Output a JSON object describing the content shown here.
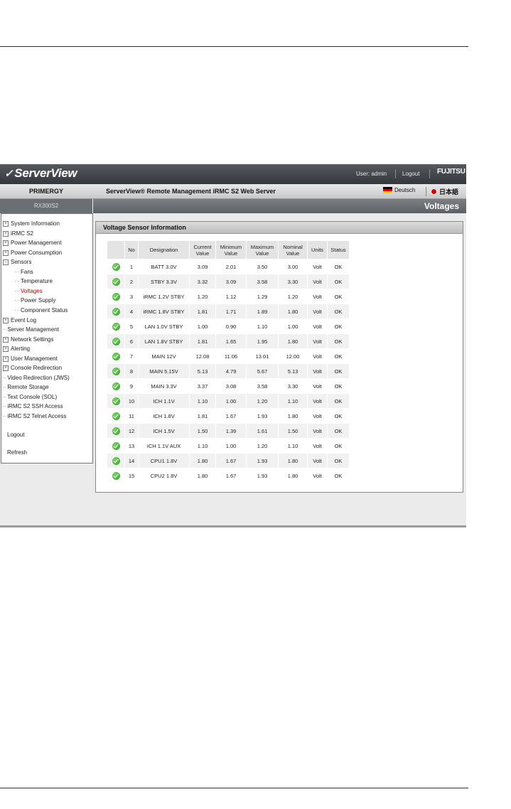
{
  "header": {
    "logo": "ServerView",
    "user": "User: admin",
    "logout": "Logout",
    "brand": "FUJITSU"
  },
  "subheader": {
    "product": "PRIMERGY",
    "title": "ServerView® Remote Management iRMC S2 Web Server",
    "lang_de": "Deutsch",
    "lang_jp": "日本語"
  },
  "model": "RX300S2",
  "page_title": "Voltages",
  "sidebar": {
    "items": [
      {
        "label": "System Information"
      },
      {
        "label": "iRMC S2"
      },
      {
        "label": "Power Management"
      },
      {
        "label": "Power Consumption"
      },
      {
        "label": "Sensors"
      },
      {
        "label": "Fans"
      },
      {
        "label": "Temperature"
      },
      {
        "label": "Voltages"
      },
      {
        "label": "Power Supply"
      },
      {
        "label": "Component Status"
      },
      {
        "label": "Event Log"
      },
      {
        "label": "Server Management"
      },
      {
        "label": "Network Settings"
      },
      {
        "label": "Alerting"
      },
      {
        "label": "User Management"
      },
      {
        "label": "Console Redirection"
      },
      {
        "label": "Video Redirection (JWS)"
      },
      {
        "label": "Remote Storage"
      },
      {
        "label": "Text Console (SOL)"
      },
      {
        "label": "iRMC S2 SSH Access"
      },
      {
        "label": "iRMC S2 Telnet Access"
      },
      {
        "label": "Logout"
      },
      {
        "label": "Refresh"
      }
    ]
  },
  "panel": {
    "title": "Voltage Sensor Information",
    "columns": {
      "no": "No",
      "designation": "Designation",
      "current_1": "Current",
      "current_2": "Value",
      "minimum_1": "Minimum",
      "minimum_2": "Value",
      "maximum_1": "Maximum",
      "maximum_2": "Value",
      "nominal_1": "Nominal",
      "nominal_2": "Value",
      "units": "Units",
      "status": "Status"
    },
    "rows": [
      {
        "no": "1",
        "designation": "BATT 3.0V",
        "current": "3.09",
        "minimum": "2.01",
        "maximum": "3.50",
        "nominal": "3.00",
        "units": "Volt",
        "status": "OK"
      },
      {
        "no": "2",
        "designation": "STBY 3.3V",
        "current": "3.32",
        "minimum": "3.09",
        "maximum": "3.58",
        "nominal": "3.30",
        "units": "Volt",
        "status": "OK"
      },
      {
        "no": "3",
        "designation": "iRMC 1.2V STBY",
        "current": "1.20",
        "minimum": "1.12",
        "maximum": "1.29",
        "nominal": "1.20",
        "units": "Volt",
        "status": "OK"
      },
      {
        "no": "4",
        "designation": "iRMC 1.8V STBY",
        "current": "1.81",
        "minimum": "1.71",
        "maximum": "1.89",
        "nominal": "1.80",
        "units": "Volt",
        "status": "OK"
      },
      {
        "no": "5",
        "designation": "LAN 1.0V STBY",
        "current": "1.00",
        "minimum": "0.90",
        "maximum": "1.10",
        "nominal": "1.00",
        "units": "Volt",
        "status": "OK"
      },
      {
        "no": "6",
        "designation": "LAN 1.8V STBY",
        "current": "1.81",
        "minimum": "1.65",
        "maximum": "1.95",
        "nominal": "1.80",
        "units": "Volt",
        "status": "OK"
      },
      {
        "no": "7",
        "designation": "MAIN 12V",
        "current": "12.08",
        "minimum": "11.06",
        "maximum": "13.01",
        "nominal": "12.00",
        "units": "Volt",
        "status": "OK"
      },
      {
        "no": "8",
        "designation": "MAIN 5.15V",
        "current": "5.13",
        "minimum": "4.79",
        "maximum": "5.67",
        "nominal": "5.13",
        "units": "Volt",
        "status": "OK"
      },
      {
        "no": "9",
        "designation": "MAIN 3.3V",
        "current": "3.37",
        "minimum": "3.08",
        "maximum": "3.58",
        "nominal": "3.30",
        "units": "Volt",
        "status": "OK"
      },
      {
        "no": "10",
        "designation": "ICH 1.1V",
        "current": "1.10",
        "minimum": "1.00",
        "maximum": "1.20",
        "nominal": "1.10",
        "units": "Volt",
        "status": "OK"
      },
      {
        "no": "11",
        "designation": "ICH 1.8V",
        "current": "1.81",
        "minimum": "1.67",
        "maximum": "1.93",
        "nominal": "1.80",
        "units": "Volt",
        "status": "OK"
      },
      {
        "no": "12",
        "designation": "ICH 1.5V",
        "current": "1.50",
        "minimum": "1.39",
        "maximum": "1.61",
        "nominal": "1.50",
        "units": "Volt",
        "status": "OK"
      },
      {
        "no": "13",
        "designation": "ICH 1.1V AUX",
        "current": "1.10",
        "minimum": "1.00",
        "maximum": "1.20",
        "nominal": "1.10",
        "units": "Volt",
        "status": "OK"
      },
      {
        "no": "14",
        "designation": "CPU1 1.8V",
        "current": "1.80",
        "minimum": "1.67",
        "maximum": "1.93",
        "nominal": "1.80",
        "units": "Volt",
        "status": "OK"
      },
      {
        "no": "15",
        "designation": "CPU2 1.8V",
        "current": "1.80",
        "minimum": "1.67",
        "maximum": "1.93",
        "nominal": "1.80",
        "units": "Volt",
        "status": "OK"
      }
    ]
  },
  "colors": {
    "header_dark": "#3a3d41",
    "active_nav": "#c00000",
    "ok_green": "#3aa62a"
  },
  "icons": {
    "status_ok": "green-check-circle-icon",
    "expand": "plus-box-icon"
  }
}
